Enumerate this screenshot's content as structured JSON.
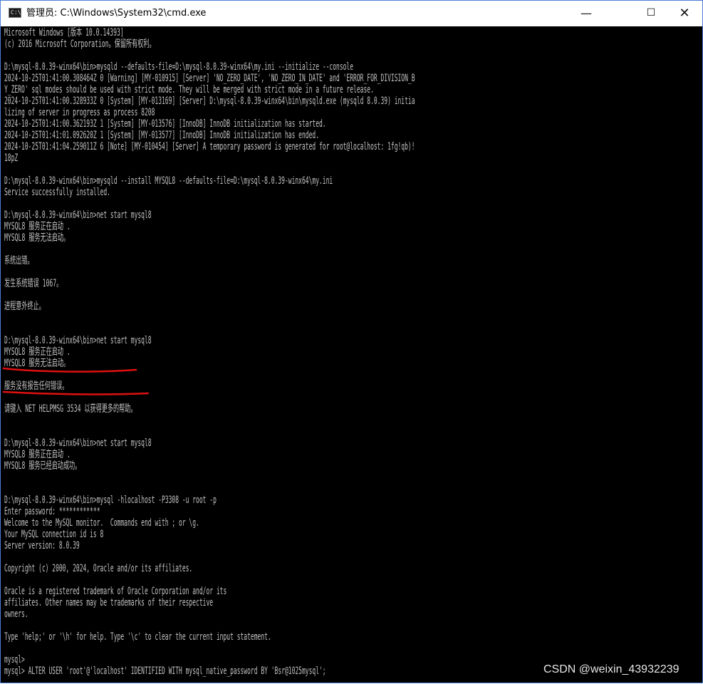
{
  "window": {
    "title": "管理员: C:\\Windows\\System32\\cmd.exe",
    "icon": "cmd-icon",
    "controls": {
      "minimize": "—",
      "maximize": "☐",
      "close": "✕"
    }
  },
  "console": {
    "lines": [
      "Microsoft Windows [版本 10.0.14393]",
      "(c) 2016 Microsoft Corporation。保留所有权利。",
      "",
      "D:\\mysql-8.0.39-winx64\\bin>mysqld --defaults-file=D:\\mysql-8.0.39-winx64\\my.ini --initialize --console",
      "2024-10-25T01:41:00.308464Z 0 [Warning] [MY-010915] [Server] 'NO_ZERO_DATE', 'NO_ZERO_IN_DATE' and 'ERROR_FOR_DIVISION_B",
      "Y_ZERO' sql modes should be used with strict mode. They will be merged with strict mode in a future release.",
      "2024-10-25T01:41:00.328933Z 0 [System] [MY-013169] [Server] D:\\mysql-8.0.39-winx64\\bin\\mysqld.exe (mysqld 8.0.39) initia",
      "lizing of server in progress as process 8208",
      "2024-10-25T01:41:00.362193Z 1 [System] [MY-013576] [InnoDB] InnoDB initialization has started.",
      "2024-10-25T01:41:01.092620Z 1 [System] [MY-013577] [InnoDB] InnoDB initialization has ended.",
      "2024-10-25T01:41:04.259011Z 6 [Note] [MY-010454] [Server] A temporary password is generated for root@localhost: 1fg!qb)!",
      "18pZ",
      "",
      "D:\\mysql-8.0.39-winx64\\bin>mysqld --install MYSQL8 --defaults-file=D:\\mysql-8.0.39-winx64\\my.ini",
      "Service successfully installed.",
      "",
      "D:\\mysql-8.0.39-winx64\\bin>net start mysql8",
      "MYSQL8 服务正在启动 .",
      "MYSQL8 服务无法启动。",
      "",
      "系统出错。",
      "",
      "发生系统错误 1067。",
      "",
      "进程意外终止。",
      "",
      "",
      "D:\\mysql-8.0.39-winx64\\bin>net start mysql8",
      "MYSQL8 服务正在启动 .",
      "MYSQL8 服务无法启动。",
      "",
      "服务没有报告任何错误。",
      "",
      "请键入 NET HELPMSG 3534 以获得更多的帮助。",
      "",
      "",
      "D:\\mysql-8.0.39-winx64\\bin>net start mysql8",
      "MYSQL8 服务正在启动 .",
      "MYSQL8 服务已经启动成功。",
      "",
      "",
      "D:\\mysql-8.0.39-winx64\\bin>mysql -hlocalhost -P3308 -u root -p",
      "Enter password: ************",
      "Welcome to the MySQL monitor.  Commands end with ; or \\g.",
      "Your MySQL connection id is 8",
      "Server version: 8.0.39",
      "",
      "Copyright (c) 2000, 2024, Oracle and/or its affiliates.",
      "",
      "Oracle is a registered trademark of Oracle Corporation and/or its",
      "affiliates. Other names may be trademarks of their respective",
      "owners.",
      "",
      "Type 'help;' or '\\h' for help. Type '\\c' to clear the current input statement.",
      "",
      "mysql>",
      "mysql> ALTER USER 'root'@'localhost' IDENTIFIED WITH mysql_native_password BY 'Bsr@1025mysql';"
    ]
  },
  "watermark": "CSDN @weixin_43932239",
  "colors": {
    "console_bg": "#000000",
    "console_text": "#c0c0c0",
    "annotation": "#e01010",
    "titlebar_bg": "#ffffff"
  }
}
